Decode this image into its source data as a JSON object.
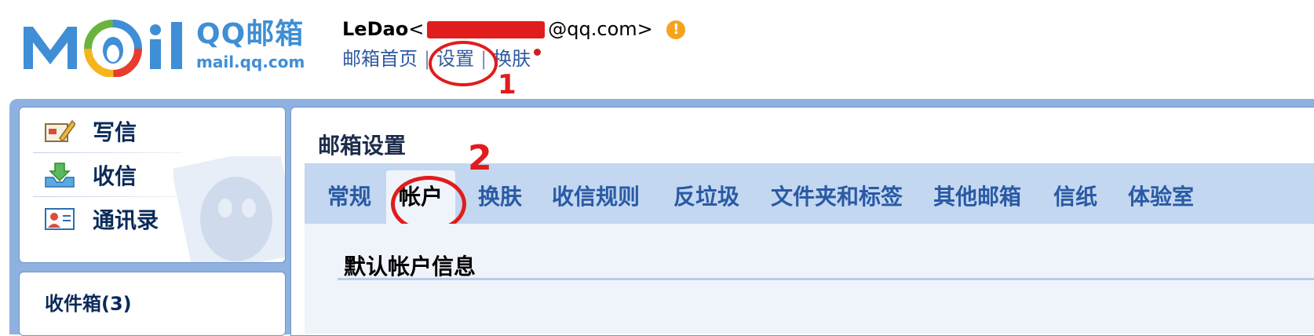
{
  "header": {
    "logo_name": "QQ邮箱",
    "logo_url": "mail.qq.com",
    "user_name": "LeDao",
    "email_open": "<",
    "email_suffix": "@qq.com>",
    "warning_glyph": "!",
    "nav": {
      "home": "邮箱首页",
      "settings": "设置",
      "skin": "换肤",
      "separator": "|"
    },
    "annotation_1": "1"
  },
  "sidebar": {
    "quick_links": [
      {
        "label": "写信",
        "icon": "compose-icon"
      },
      {
        "label": "收信",
        "icon": "receive-icon"
      },
      {
        "label": "通讯录",
        "icon": "contacts-icon"
      }
    ],
    "inbox_label": "收件箱(3)"
  },
  "settings": {
    "title": "邮箱设置",
    "tabs": [
      {
        "label": "常规"
      },
      {
        "label": "帐户",
        "active": true
      },
      {
        "label": "换肤"
      },
      {
        "label": "收信规则"
      },
      {
        "label": "反垃圾"
      },
      {
        "label": "文件夹和标签"
      },
      {
        "label": "其他邮箱"
      },
      {
        "label": "信纸"
      },
      {
        "label": "体验室"
      }
    ],
    "annotation_2": "2",
    "section_title": "默认帐户信息"
  },
  "colors": {
    "brand_blue": "#3f8ed6",
    "link_blue": "#2f5aa0",
    "frame_blue": "#8fb1df",
    "tab_bar_bg": "#c3d7f0",
    "annotation_red": "#e11c1c",
    "warning_orange": "#f5a31b"
  }
}
